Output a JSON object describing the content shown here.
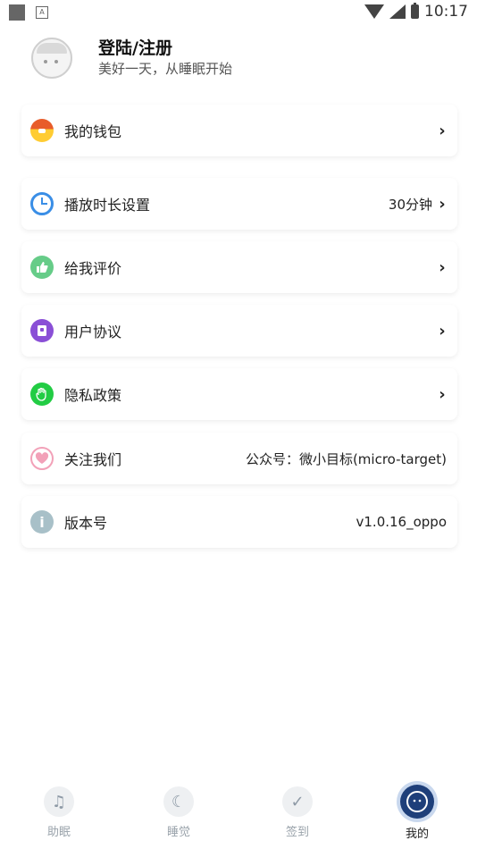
{
  "status_bar": {
    "time": "10:17",
    "notif_icon": "A"
  },
  "profile": {
    "title": "登陆/注册",
    "subtitle": "美好一天，从睡眠开始"
  },
  "menu": [
    {
      "label": "我的钱包",
      "value": "",
      "chevron": "›",
      "icon": "wallet-icon"
    },
    {
      "label": "播放时长设置",
      "value": "30分钟",
      "chevron": "›",
      "icon": "clock-icon"
    },
    {
      "label": "给我评价",
      "value": "",
      "chevron": "›",
      "icon": "thumbs-up-icon"
    },
    {
      "label": "用户协议",
      "value": "",
      "chevron": "›",
      "icon": "document-icon"
    },
    {
      "label": "隐私政策",
      "value": "",
      "chevron": "›",
      "icon": "hand-icon"
    },
    {
      "label": "关注我们",
      "value": "公众号：微小目标(micro-target)",
      "chevron": "",
      "icon": "heart-icon"
    },
    {
      "label": "版本号",
      "value": "v1.0.16_oppo",
      "chevron": "",
      "icon": "info-icon"
    }
  ],
  "tabs": [
    {
      "label": "助眠",
      "icon": "music-note-icon"
    },
    {
      "label": "睡觉",
      "icon": "sleep-moon-icon"
    },
    {
      "label": "签到",
      "icon": "checkin-inbox-icon"
    },
    {
      "label": "我的",
      "icon": "profile-face-icon"
    }
  ],
  "colors": {
    "accent": "#1e3f7a",
    "tab_inactive": "#9aa3ab"
  }
}
